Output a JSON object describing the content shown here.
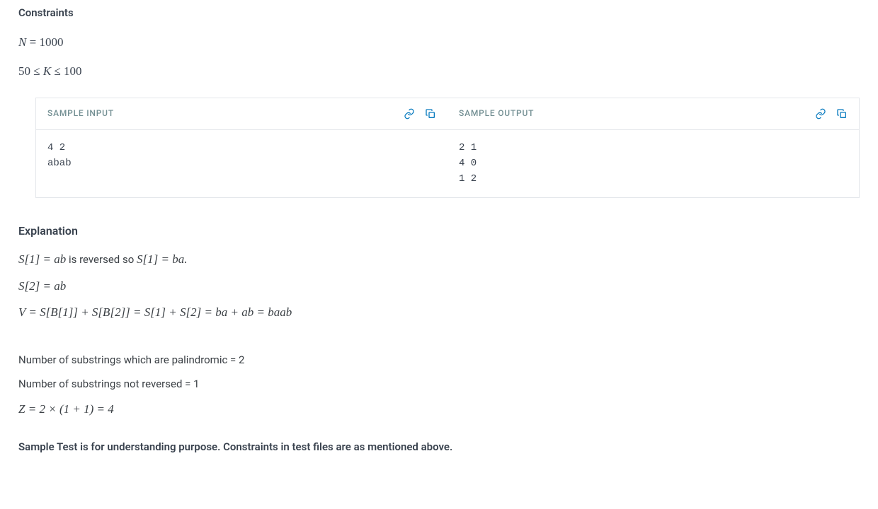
{
  "constraints": {
    "heading": "Constraints",
    "line1_html": "N = 1000",
    "line2_html": "50 ≤ K ≤ 100"
  },
  "sample_input": {
    "label": "SAMPLE INPUT",
    "content": "4 2\nabab"
  },
  "sample_output": {
    "label": "SAMPLE OUTPUT",
    "content": "2 1\n4 0\n1 2"
  },
  "explanation": {
    "heading": "Explanation",
    "line1_prefix": "S[1] = ab",
    "line1_mid": " is reversed so ",
    "line1_suffix": "S[1] = ba.",
    "line2": "S[2] = ab",
    "line3": "V = S[B[1]] + S[B[2]] = S[1] + S[2] = ba + ab = baab",
    "pal_line": "Number of substrings which are palindromic = 2",
    "notrev_line": "Number of substrings not reversed = 1",
    "z_line": "Z = 2 × (1 + 1) = 4",
    "note": "Sample Test is for understanding purpose. Constraints in test files are as mentioned above."
  }
}
